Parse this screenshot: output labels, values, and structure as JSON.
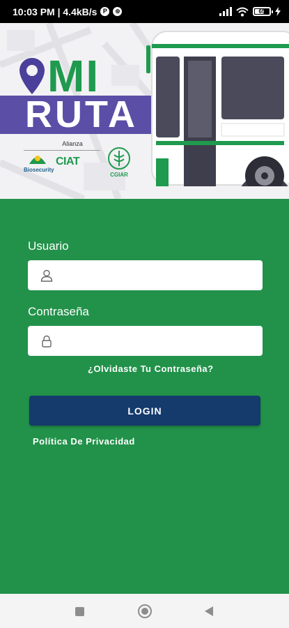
{
  "status_bar": {
    "time_speed": "10:03 PM | 4.4kB/s",
    "battery": "65"
  },
  "header": {
    "logo_mi": "MI",
    "logo_ruta": "RUTA",
    "alliances_label": "Alianza",
    "partners": [
      "Biosecurity",
      "CIAT",
      "CGIAR"
    ]
  },
  "form": {
    "username_label": "Usuario",
    "username_value": "",
    "password_label": "Contraseña",
    "password_value": "",
    "forgot_link": "¿Olvidaste Tu Contraseña?",
    "login_button": "LOGIN",
    "privacy_link": "Política De Privacidad"
  },
  "colors": {
    "form_bg": "#22924a",
    "login_button": "#143b6c",
    "ruta_band": "#5a4ea6",
    "logo_green": "#1f9a4e"
  },
  "icons": [
    "user-icon",
    "lock-icon",
    "location-pin-icon",
    "bus-illustration"
  ]
}
